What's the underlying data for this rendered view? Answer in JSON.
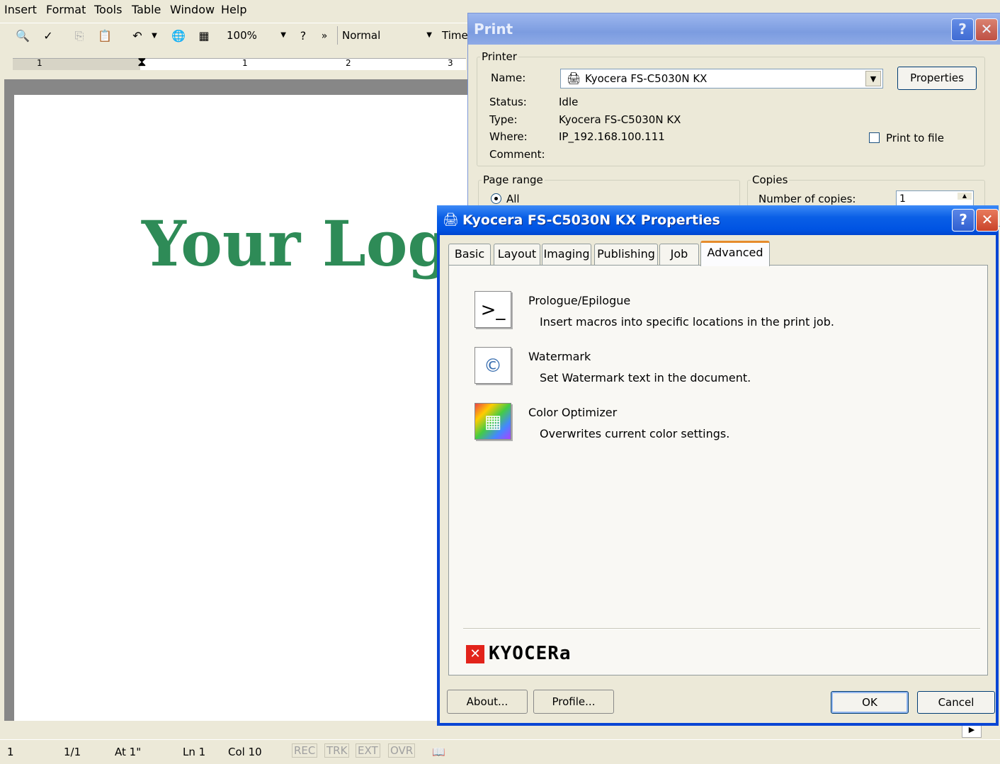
{
  "word": {
    "menu": [
      "Insert",
      "Format",
      "Tools",
      "Table",
      "Window",
      "Help"
    ],
    "toolbar": {
      "zoom": "100%",
      "style": "Normal",
      "font": "Times",
      "more": "»"
    },
    "ruler_numbers": [
      "1",
      "1",
      "2",
      "3"
    ],
    "logo_text": "Your Logo",
    "statusbar": {
      "page": "1",
      "pages": "1/1",
      "at": "At 1\"",
      "ln": "Ln 1",
      "col": "Col 10",
      "rec": "REC",
      "trk": "TRK",
      "ext": "EXT",
      "ovr": "OVR"
    }
  },
  "print_dialog": {
    "title": "Print",
    "printer_group": "Printer",
    "name_label": "Name:",
    "name_value": "Kyocera FS-C5030N KX",
    "properties_button": "Properties",
    "status_label": "Status:",
    "status_value": "Idle",
    "type_label": "Type:",
    "type_value": "Kyocera FS-C5030N KX",
    "where_label": "Where:",
    "where_value": "IP_192.168.100.111",
    "comment_label": "Comment:",
    "print_to_file": "Print to file",
    "page_range_group": "Page range",
    "all_option": "All",
    "copies_group": "Copies",
    "copies_label": "Number of copies:",
    "copies_value": "1"
  },
  "props_dialog": {
    "title": "Kyocera FS-C5030N KX Properties",
    "tabs": [
      "Basic",
      "Layout",
      "Imaging",
      "Publishing",
      "Job",
      "Advanced"
    ],
    "active_tab": "Advanced",
    "features": [
      {
        "title": "Prologue/Epilogue",
        "desc": "Insert macros into specific locations in the print job.",
        "icon": "prologue-epilogue-icon"
      },
      {
        "title": "Watermark",
        "desc": "Set Watermark text in the document.",
        "icon": "watermark-icon"
      },
      {
        "title": "Color Optimizer",
        "desc": "Overwrites current color settings.",
        "icon": "color-optimizer-icon"
      }
    ],
    "brand": "KYOCERa",
    "about_button": "About...",
    "profile_button": "Profile...",
    "ok_button": "OK",
    "cancel_button": "Cancel"
  },
  "colors": {
    "logo_green": "#2e8b57",
    "xp_blue": "#0054e3",
    "kyocera_red": "#e2231a"
  }
}
